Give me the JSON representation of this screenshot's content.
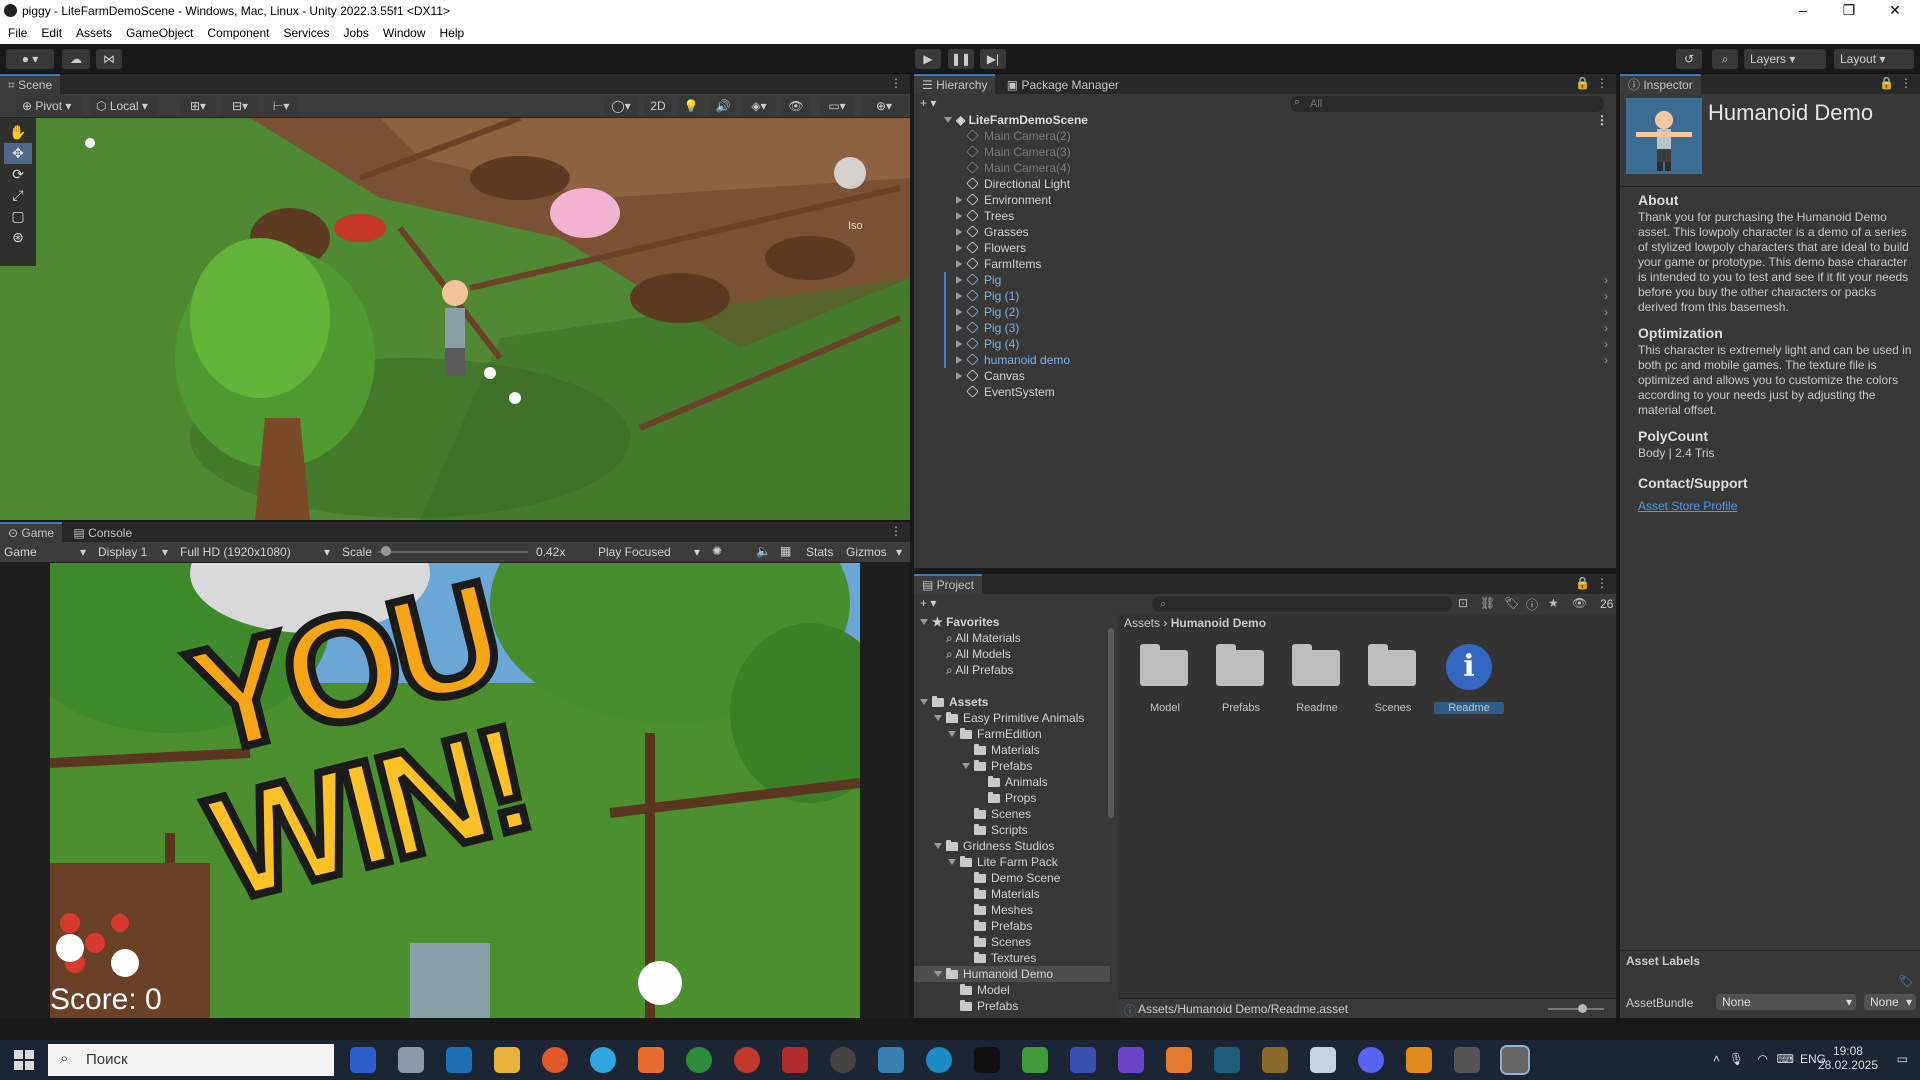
{
  "window": {
    "title": "piggy - LiteFarmDemoScene - Windows, Mac, Linux - Unity 2022.3.55f1 <DX11>",
    "minimize": "–",
    "maximize": "❐",
    "close": "✕"
  },
  "menu": [
    "File",
    "Edit",
    "Assets",
    "GameObject",
    "Component",
    "Services",
    "Jobs",
    "Window",
    "Help"
  ],
  "toolbar": {
    "layers": "Layers",
    "layout": "Layout"
  },
  "scene": {
    "tab": "Scene",
    "pivot": "Pivot",
    "local": "Local",
    "mode2d": "2D",
    "gizmo_label": "Iso"
  },
  "game": {
    "tabs": [
      "Game",
      "Console"
    ],
    "display_mode": "Game",
    "display": "Display 1",
    "resolution": "Full HD (1920x1080)",
    "scale_label": "Scale",
    "scale_value": "0.42x",
    "scale_fraction": 0.02,
    "play_focused": "Play Focused",
    "stats": "Stats",
    "gizmos": "Gizmos",
    "win_text_1": "YOU",
    "win_text_2": "WIN!",
    "score": "Score: 0"
  },
  "hierarchy": {
    "tabs": [
      "Hierarchy",
      "Package Manager"
    ],
    "search_placeholder": "All",
    "scene_name": "LiteFarmDemoScene",
    "items": [
      {
        "label": "Main Camera(2)",
        "state": "disabled",
        "expand": false
      },
      {
        "label": "Main Camera(3)",
        "state": "disabled",
        "expand": false
      },
      {
        "label": "Main Camera(4)",
        "state": "disabled",
        "expand": false
      },
      {
        "label": "Directional Light",
        "state": "normal",
        "expand": false
      },
      {
        "label": "Environment",
        "state": "normal",
        "expand": true
      },
      {
        "label": "Trees",
        "state": "normal",
        "expand": true
      },
      {
        "label": "Grasses",
        "state": "normal",
        "expand": true
      },
      {
        "label": "Flowers",
        "state": "normal",
        "expand": true
      },
      {
        "label": "FarmItems",
        "state": "normal",
        "expand": true
      },
      {
        "label": "Pig",
        "state": "prefab",
        "expand": true
      },
      {
        "label": "Pig (1)",
        "state": "prefab",
        "expand": true
      },
      {
        "label": "Pig (2)",
        "state": "prefab",
        "expand": true
      },
      {
        "label": "Pig (3)",
        "state": "prefab",
        "expand": true
      },
      {
        "label": "Pig (4)",
        "state": "prefab",
        "expand": true
      },
      {
        "label": "humanoid demo",
        "state": "prefab",
        "expand": true
      },
      {
        "label": "Canvas",
        "state": "normal",
        "expand": true
      },
      {
        "label": "EventSystem",
        "state": "normal",
        "expand": false
      }
    ]
  },
  "inspector": {
    "tab": "Inspector",
    "title": "Humanoid Demo",
    "sections": [
      {
        "heading": "About",
        "body": "Thank you for purchasing the Humanoid Demo asset. This lowpoly character is a demo of a series of stylized lowpoly characters that are ideal to build your game or prototype. This demo base character is intended to you to test and see if it fit your needs before you buy the other characters or packs derived from this basemesh."
      },
      {
        "heading": "Optimization",
        "body": "This character is extremely light and can be used in both pc and mobile games. The texture file is optimized and allows you to customize the colors according to your needs just by adjusting the material offset."
      },
      {
        "heading": "PolyCount",
        "body": "Body | 2.4 Tris"
      },
      {
        "heading": "Contact/Support",
        "body": ""
      }
    ],
    "link": "Asset Store Profile",
    "asset_labels": "Asset Labels",
    "assetbundle_label": "AssetBundle",
    "assetbundle_value": "None",
    "variant_value": "None"
  },
  "project": {
    "tab": "Project",
    "count": "26",
    "breadcrumb_root": "Assets",
    "breadcrumb_current": "Humanoid Demo",
    "tree": [
      {
        "label": "Favorites",
        "depth": 0,
        "kind": "star",
        "bold": true,
        "expand": "open"
      },
      {
        "label": "All Materials",
        "depth": 1,
        "kind": "search"
      },
      {
        "label": "All Models",
        "depth": 1,
        "kind": "search"
      },
      {
        "label": "All Prefabs",
        "depth": 1,
        "kind": "search"
      },
      {
        "label": "",
        "depth": 0,
        "kind": "gap"
      },
      {
        "label": "Assets",
        "depth": 0,
        "kind": "folder",
        "bold": true,
        "expand": "open"
      },
      {
        "label": "Easy Primitive Animals",
        "depth": 1,
        "kind": "folder",
        "expand": "open"
      },
      {
        "label": "FarmEdition",
        "depth": 2,
        "kind": "folder",
        "expand": "open"
      },
      {
        "label": "Materials",
        "depth": 3,
        "kind": "folder"
      },
      {
        "label": "Prefabs",
        "depth": 3,
        "kind": "folder",
        "expand": "open"
      },
      {
        "label": "Animals",
        "depth": 4,
        "kind": "folder"
      },
      {
        "label": "Props",
        "depth": 4,
        "kind": "folder"
      },
      {
        "label": "Scenes",
        "depth": 3,
        "kind": "folder"
      },
      {
        "label": "Scripts",
        "depth": 3,
        "kind": "folder"
      },
      {
        "label": "Gridness Studios",
        "depth": 1,
        "kind": "folder",
        "expand": "open"
      },
      {
        "label": "Lite Farm Pack",
        "depth": 2,
        "kind": "folder",
        "expand": "open"
      },
      {
        "label": "Demo Scene",
        "depth": 3,
        "kind": "folder"
      },
      {
        "label": "Materials",
        "depth": 3,
        "kind": "folder"
      },
      {
        "label": "Meshes",
        "depth": 3,
        "kind": "folder"
      },
      {
        "label": "Prefabs",
        "depth": 3,
        "kind": "folder"
      },
      {
        "label": "Scenes",
        "depth": 3,
        "kind": "folder"
      },
      {
        "label": "Textures",
        "depth": 3,
        "kind": "folder"
      },
      {
        "label": "Humanoid Demo",
        "depth": 1,
        "kind": "folder",
        "expand": "open",
        "selected": true
      },
      {
        "label": "Model",
        "depth": 2,
        "kind": "folder"
      },
      {
        "label": "Prefabs",
        "depth": 2,
        "kind": "folder"
      }
    ],
    "assets": [
      {
        "label": "Model",
        "kind": "folder"
      },
      {
        "label": "Prefabs",
        "kind": "folder"
      },
      {
        "label": "Readme",
        "kind": "folder"
      },
      {
        "label": "Scenes",
        "kind": "folder"
      },
      {
        "label": "Readme",
        "kind": "info"
      }
    ],
    "status_path": "Assets/Humanoid Demo/Readme.asset"
  },
  "taskbar": {
    "search_placeholder": "Поиск",
    "lang": "ENG",
    "time": "19:08",
    "date": "28.02.2025"
  }
}
